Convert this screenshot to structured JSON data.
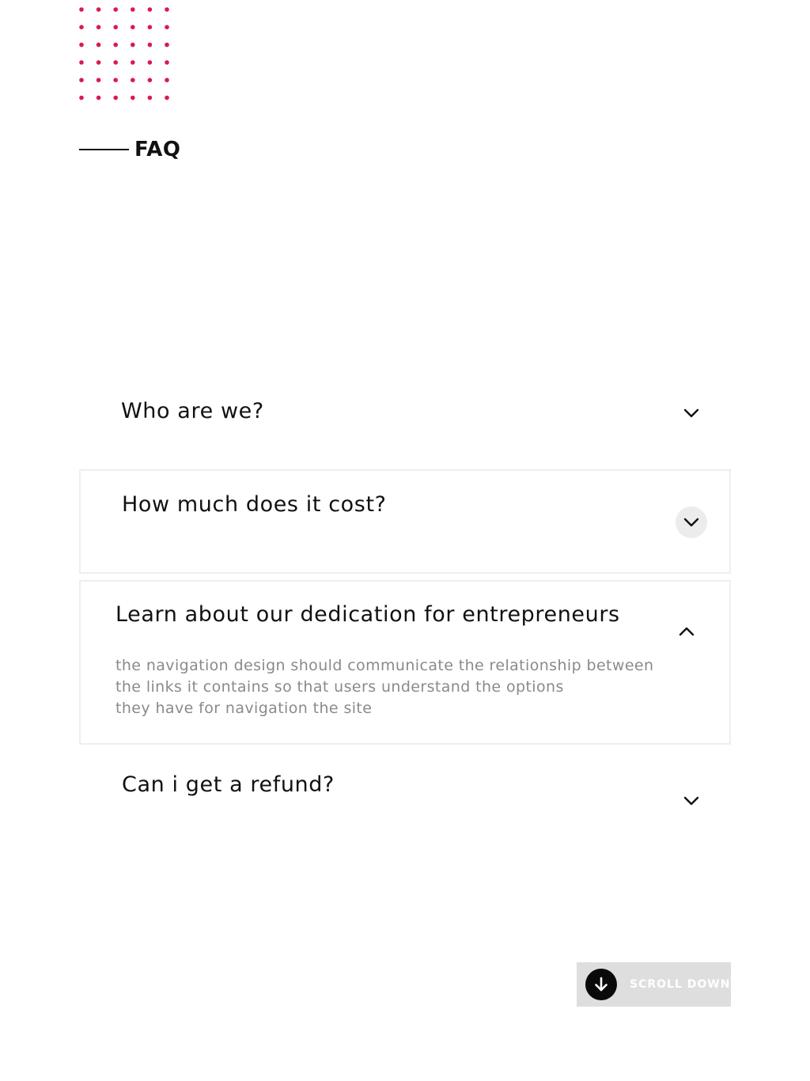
{
  "section": {
    "label": "FAQ"
  },
  "faq": {
    "items": [
      {
        "question": "Who are we?",
        "state": "collapsed",
        "toggle_icon": "chevron-down-icon"
      },
      {
        "question": "How much does it cost?",
        "state": "collapsed-hover",
        "toggle_icon": "chevron-down-icon"
      },
      {
        "question": "Learn about our dedication for entrepreneurs",
        "answer": "the navigation design should communicate the relationship between\nthe links it contains so that users understand the options\nthey have for navigation the site",
        "state": "expanded",
        "toggle_icon": "chevron-up-icon"
      },
      {
        "question": "Can i get a refund?",
        "state": "collapsed",
        "toggle_icon": "chevron-down-icon"
      }
    ]
  },
  "scroll": {
    "label": "SCROLL DOWN",
    "icon": "arrow-down-icon"
  },
  "colors": {
    "accent_dots": "#d81b4b",
    "text_primary": "#111111",
    "text_muted": "#8a8a8a",
    "border": "#eeeeee",
    "scroll_bg": "#dedede"
  }
}
